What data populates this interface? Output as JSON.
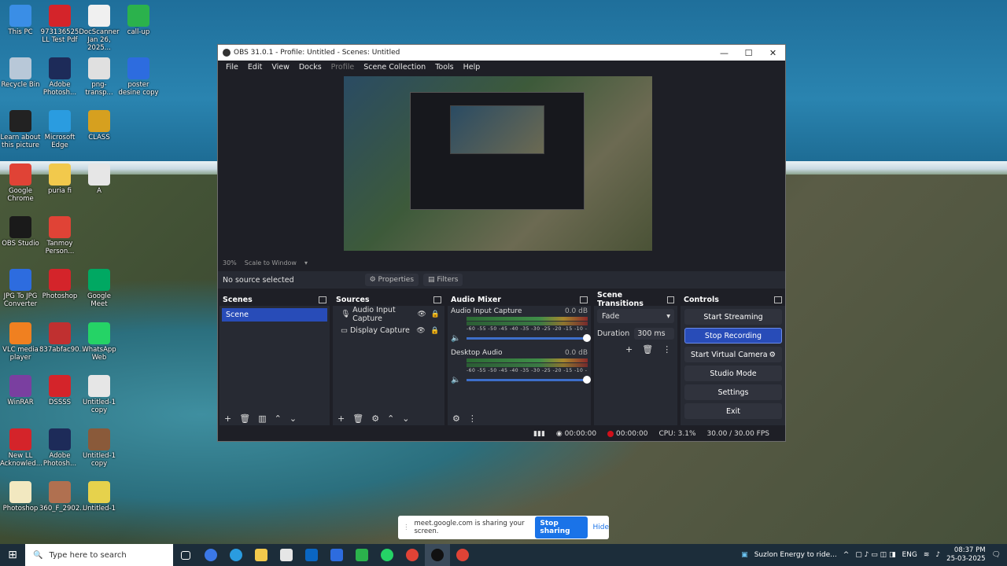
{
  "desktop": {
    "icons": [
      {
        "label": "This PC",
        "color": "#3a8ee6"
      },
      {
        "label": "973136525 LL Test Pdf",
        "color": "#d4242a"
      },
      {
        "label": "DocScanner Jan 26, 2025...",
        "color": "#f0f0f0"
      },
      {
        "label": "call-up",
        "color": "#2bb24c"
      },
      {
        "label": "Recycle Bin",
        "color": "#b8c8d8"
      },
      {
        "label": "Adobe Photosh...",
        "color": "#1d2b59"
      },
      {
        "label": "png-transp...",
        "color": "#e0e0e0"
      },
      {
        "label": "poster desine copy",
        "color": "#2d6cdf"
      },
      {
        "label": "Learn about this picture",
        "color": "#222222"
      },
      {
        "label": "Microsoft Edge",
        "color": "#2a9ce0"
      },
      {
        "label": "CLASS",
        "color": "#d6a01f"
      },
      {
        "label": "Google Chrome",
        "color": "#e04336"
      },
      {
        "label": "puria fi",
        "color": "#f2c94c"
      },
      {
        "label": "A",
        "color": "#e6e6e6"
      },
      {
        "label": "OBS Studio",
        "color": "#1a1a1a"
      },
      {
        "label": "Tanmoy Person...",
        "color": "#e04336"
      },
      {
        "label": "JPG To JPG Converter",
        "color": "#2d6cdf"
      },
      {
        "label": "Photoshop",
        "color": "#d4242a"
      },
      {
        "label": "Google Meet",
        "color": "#00a862"
      },
      {
        "label": "VLC media player",
        "color": "#f08020"
      },
      {
        "label": "837abfac90...",
        "color": "#c03030"
      },
      {
        "label": "WhatsApp Web",
        "color": "#25d366"
      },
      {
        "label": "WinRAR",
        "color": "#7a3fa0"
      },
      {
        "label": "DSSSS",
        "color": "#d4242a"
      },
      {
        "label": "Untitled-1 copy",
        "color": "#e6e6e6"
      },
      {
        "label": "New LL Acknowled...",
        "color": "#d4242a"
      },
      {
        "label": "Adobe Photosh...",
        "color": "#1d2b59"
      },
      {
        "label": "Untitled-1 copy",
        "color": "#8a5a3a"
      },
      {
        "label": "Photoshop",
        "color": "#f2e8c0"
      },
      {
        "label": "360_F_2902...",
        "color": "#b07050"
      },
      {
        "label": "Untitled-1",
        "color": "#e6d24c"
      }
    ]
  },
  "obs": {
    "title": "OBS 31.0.1 - Profile: Untitled - Scenes: Untitled",
    "window_controls": [
      "—",
      "☐",
      "✕"
    ],
    "menu": [
      "File",
      "Edit",
      "View",
      "Docks",
      "Profile",
      "Scene Collection",
      "Tools",
      "Help"
    ],
    "zoom": "30%",
    "scale_mode": "Scale to Window",
    "no_source": "No source selected",
    "properties_btn": "Properties",
    "filters_btn": "Filters",
    "scenes": {
      "title": "Scenes",
      "items": [
        "Scene"
      ]
    },
    "sources": {
      "title": "Sources",
      "items": [
        "Audio Input Capture",
        "Display Capture"
      ]
    },
    "mixer": {
      "title": "Audio Mixer",
      "channels": [
        {
          "name": "Audio Input Capture",
          "db": "0.0 dB"
        },
        {
          "name": "Desktop Audio",
          "db": "0.0 dB"
        }
      ],
      "ticks": "-60 -55 -50 -45 -40 -35 -30 -25 -20 -15 -10 -5 0"
    },
    "transitions": {
      "title": "Scene Transitions",
      "type": "Fade",
      "duration_label": "Duration",
      "duration": "300 ms"
    },
    "controls": {
      "title": "Controls",
      "buttons": [
        "Start Streaming",
        "Stop Recording",
        "Start Virtual Camera",
        "Studio Mode",
        "Settings",
        "Exit"
      ]
    },
    "status": {
      "stream_time": "00:00:00",
      "rec_time": "00:00:00",
      "cpu": "CPU: 3.1%",
      "fps": "30.00 / 30.00 FPS"
    }
  },
  "share_bar": {
    "text": "meet.google.com is sharing your screen.",
    "stop": "Stop sharing",
    "hide": "Hide"
  },
  "taskbar": {
    "search_placeholder": "Type here to search",
    "news": "Suzlon Energy to ride...",
    "lang": "ENG",
    "time": "08:37 PM",
    "date": "25-03-2025"
  }
}
